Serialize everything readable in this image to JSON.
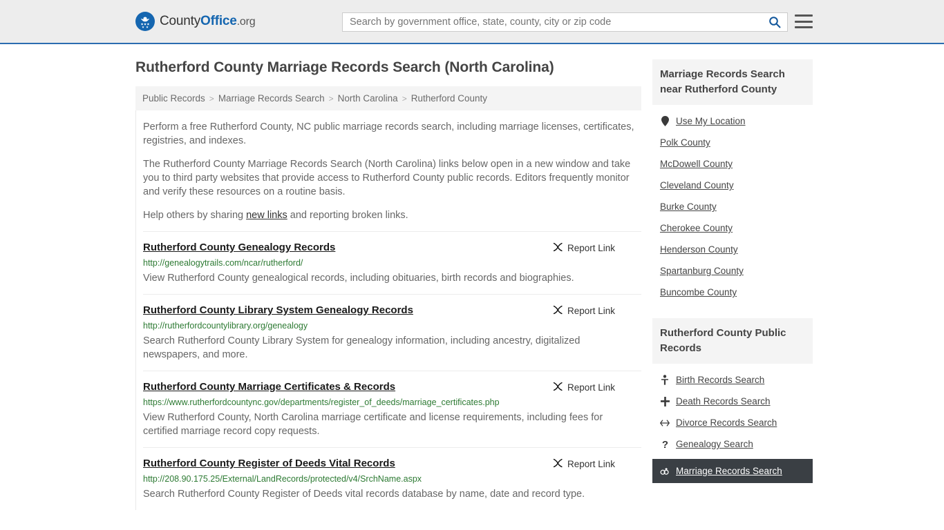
{
  "header": {
    "brand": {
      "part1": "County",
      "part2": "Office",
      "part3": ".org",
      "icon": "eagle-seal-icon"
    },
    "search": {
      "placeholder": "Search by government office, state, county, city or zip code",
      "value": "",
      "button_icon": "search-icon"
    },
    "menu_icon": "hamburger-menu-icon",
    "accent_color": "#2b6cb0"
  },
  "page_title": "Rutherford County Marriage Records Search (North Carolina)",
  "breadcrumb": {
    "separator": ">",
    "items": [
      {
        "label": "Public Records"
      },
      {
        "label": "Marriage Records Search"
      },
      {
        "label": "North Carolina"
      },
      {
        "label": "Rutherford County"
      }
    ]
  },
  "intro": {
    "p1": "Perform a free Rutherford County, NC public marriage records search, including marriage licenses, certificates, registries, and indexes.",
    "p2": "The Rutherford County Marriage Records Search (North Carolina) links below open in a new window and take you to third party websites that provide access to Rutherford County public records. Editors frequently monitor and verify these resources on a routine basis.",
    "p3_before": "Help others by sharing ",
    "p3_link": "new links",
    "p3_after": " and reporting broken links."
  },
  "report_link_label": "Report Link",
  "report_link_icon": "broken-link-icon",
  "results": [
    {
      "title": "Rutherford County Genealogy Records",
      "url": "http://genealogytrails.com/ncar/rutherford/",
      "description": "View Rutherford County genealogical records, including obituaries, birth records and biographies."
    },
    {
      "title": "Rutherford County Library System Genealogy Records",
      "url": "http://rutherfordcountylibrary.org/genealogy",
      "description": "Search Rutherford County Library System for genealogy information, including ancestry, digitalized newspapers, and more."
    },
    {
      "title": "Rutherford County Marriage Certificates & Records",
      "url": "https://www.rutherfordcountync.gov/departments/register_of_deeds/marriage_certificates.php",
      "description": "View Rutherford County, North Carolina marriage certificate and license requirements, including fees for certified marriage record copy requests."
    },
    {
      "title": "Rutherford County Register of Deeds Vital Records",
      "url": "http://208.90.175.25/External/LandRecords/protected/v4/SrchName.aspx",
      "description": "Search Rutherford County Register of Deeds vital records database by name, date and record type."
    }
  ],
  "sidebar": {
    "nearby": {
      "title": "Marriage Records Search near Rutherford County",
      "use_my_location": {
        "label": "Use My Location",
        "icon": "map-pin-icon"
      },
      "counties": [
        {
          "label": "Polk County"
        },
        {
          "label": "McDowell County"
        },
        {
          "label": "Cleveland County"
        },
        {
          "label": "Burke County"
        },
        {
          "label": "Cherokee County"
        },
        {
          "label": "Henderson County"
        },
        {
          "label": "Spartanburg County"
        },
        {
          "label": "Buncombe County"
        }
      ]
    },
    "public_records": {
      "title": "Rutherford County Public Records",
      "items": [
        {
          "label": "Birth Records Search",
          "icon": "baby-icon",
          "glyph": "Ÿ",
          "active": false
        },
        {
          "label": "Death Records Search",
          "icon": "cross-icon",
          "glyph": "✚",
          "active": false
        },
        {
          "label": "Divorce Records Search",
          "icon": "double-arrow-icon",
          "glyph": "↔",
          "active": false
        },
        {
          "label": "Genealogy Search",
          "icon": "question-mark-icon",
          "glyph": "?",
          "active": false
        },
        {
          "label": "Marriage Records Search",
          "icon": "interlocking-rings-icon",
          "glyph": "⚭",
          "active": true
        }
      ]
    }
  }
}
